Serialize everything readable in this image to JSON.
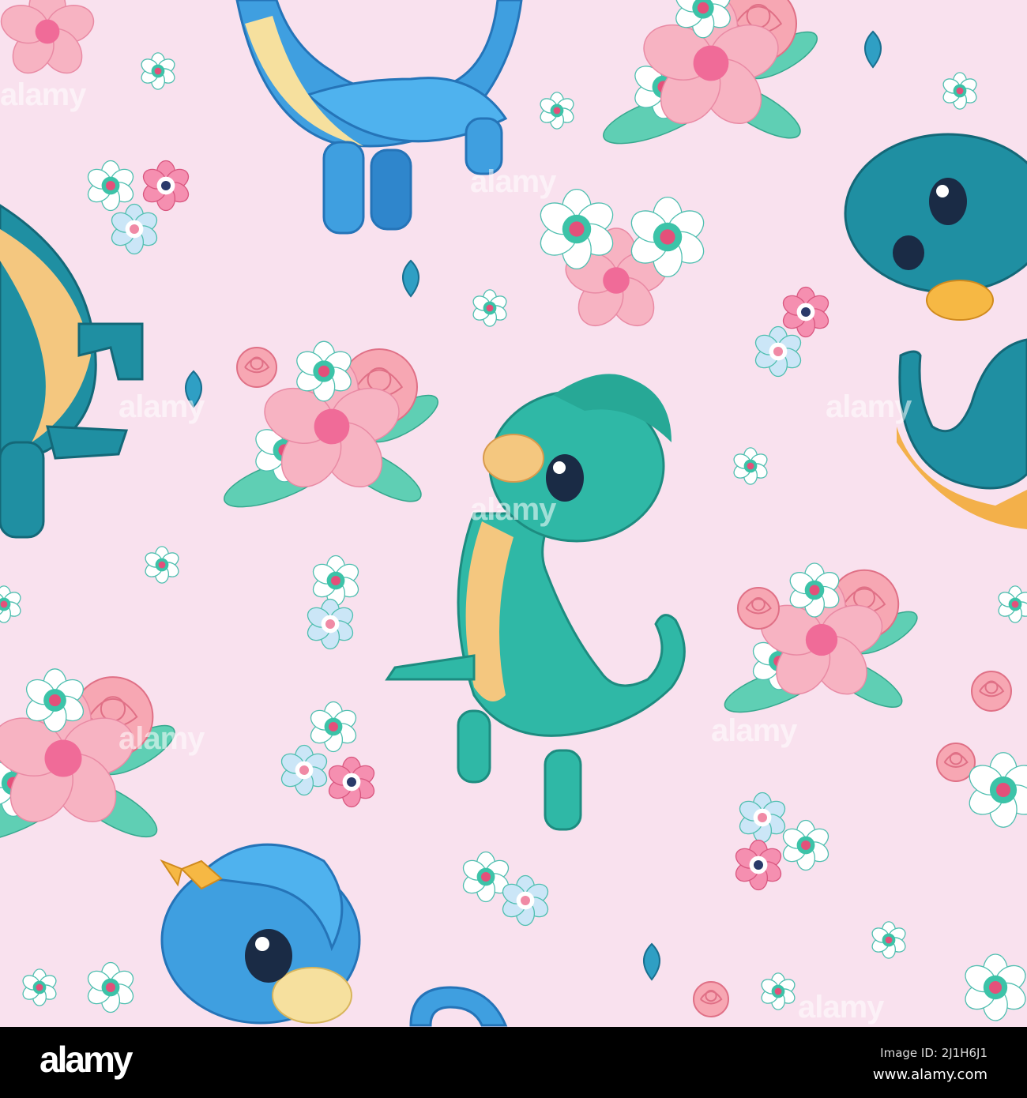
{
  "illustration": {
    "subject": "seamless pattern of cute dinosaurs and flowers",
    "colors": {
      "background": "#f9e1ee",
      "teal": "#2fb8a6",
      "blue": "#3f9fe0",
      "dark_teal": "#1f8fa2",
      "pink": "#f7b3c2",
      "rose": "#f28da0",
      "belly": "#f4c77f"
    },
    "watermark_text": "alamy"
  },
  "footer": {
    "logo": "alamy",
    "image_id": "Image ID: 2J1H6J1",
    "website": "www.alamy.com"
  }
}
